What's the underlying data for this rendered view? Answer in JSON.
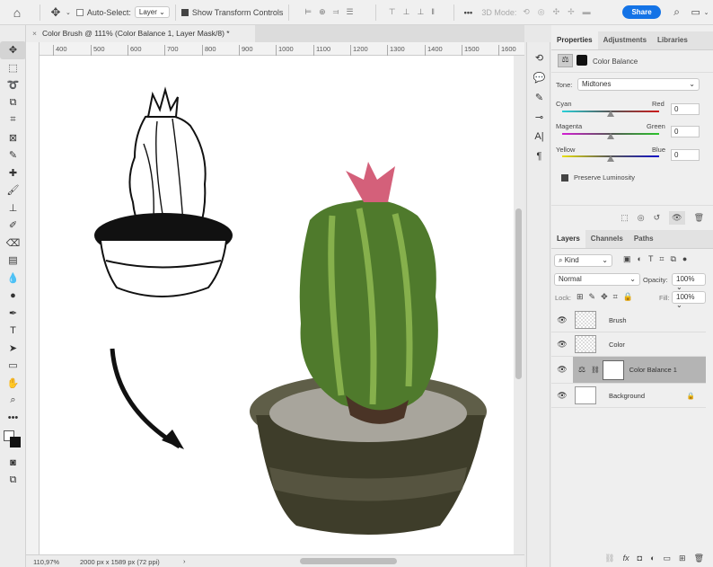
{
  "toolbar": {
    "auto_select_label": "Auto-Select:",
    "auto_select_value": "Layer",
    "show_transform_label": "Show Transform Controls",
    "three_d_label": "3D Mode:",
    "share_label": "Share"
  },
  "document": {
    "tab_title": "Color Brush @ 111% (Color Balance 1, Layer Mask/8) *",
    "ruler_ticks": [
      "400",
      "500",
      "600",
      "700",
      "800",
      "900",
      "1000",
      "1100",
      "1200",
      "1300",
      "1400",
      "1500",
      "1600"
    ],
    "zoom": "110,97%",
    "dimensions": "2000 px x 1589 px (72 ppi)"
  },
  "properties": {
    "tabs": [
      "Properties",
      "Adjustments",
      "Libraries"
    ],
    "title": "Color Balance",
    "tone_label": "Tone:",
    "tone_value": "Midtones",
    "sliders": [
      {
        "left": "Cyan",
        "right": "Red",
        "value": "0",
        "position": 0.5,
        "gradient": [
          "#2ad0d8",
          "#cc1a1a"
        ]
      },
      {
        "left": "Magenta",
        "right": "Green",
        "value": "0",
        "position": 0.5,
        "gradient": [
          "#d41ed4",
          "#2ac42a"
        ]
      },
      {
        "left": "Yellow",
        "right": "Blue",
        "value": "0",
        "position": 0.5,
        "gradient": [
          "#e8e010",
          "#1010c8"
        ]
      }
    ],
    "preserve_luminosity": "Preserve Luminosity"
  },
  "layers": {
    "tabs": [
      "Layers",
      "Channels",
      "Paths"
    ],
    "kind": "Kind",
    "blend_mode": "Normal",
    "opacity_label": "Opacity:",
    "opacity": "100%",
    "lock_label": "Lock:",
    "fill_label": "Fill:",
    "fill": "100%",
    "items": [
      {
        "name": "Brush"
      },
      {
        "name": "Color"
      },
      {
        "name": "Color Balance 1"
      },
      {
        "name": "Background"
      }
    ]
  },
  "colors": {
    "accent": "#1473e6",
    "selected_layer": "#b4b4b4"
  }
}
